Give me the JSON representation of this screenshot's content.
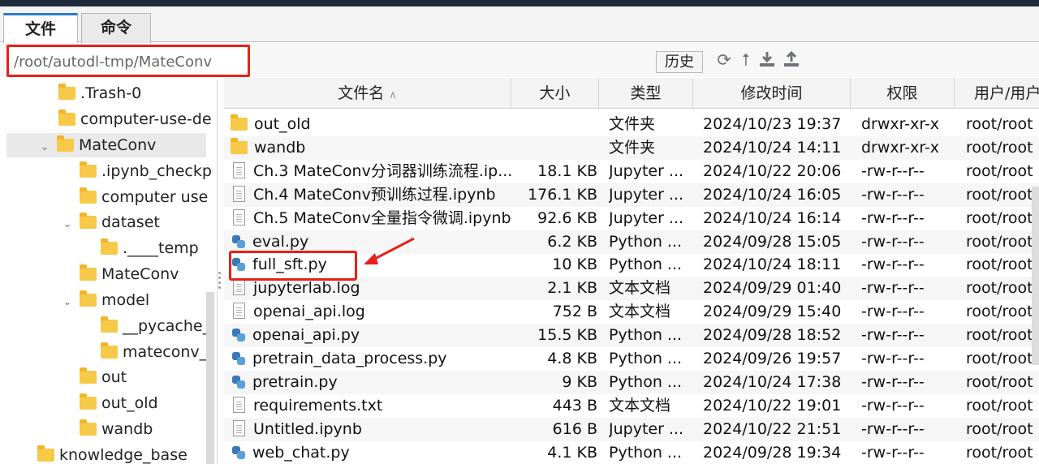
{
  "tabs": [
    {
      "label": "文件"
    },
    {
      "label": "命令"
    }
  ],
  "path": {
    "value": "/root/autodl-tmp/MateConv"
  },
  "toolbar": {
    "history_label": "历史",
    "icons": [
      "refresh-icon",
      "upload-up-icon",
      "download-icon",
      "upload-icon"
    ]
  },
  "tree": [
    {
      "label": ".Trash-0"
    },
    {
      "label": "computer-use-de"
    },
    {
      "label": "MateConv"
    },
    {
      "label": ".ipynb_checkp"
    },
    {
      "label": "computer use"
    },
    {
      "label": "dataset"
    },
    {
      "label": ".____temp"
    },
    {
      "label": "MateConv"
    },
    {
      "label": "model"
    },
    {
      "label": "__pycache_"
    },
    {
      "label": "mateconv_"
    },
    {
      "label": "out"
    },
    {
      "label": "out_old"
    },
    {
      "label": "wandb"
    },
    {
      "label": "knowledge_base"
    }
  ],
  "table": {
    "headers": {
      "name": "文件名",
      "size": "大小",
      "type": "类型",
      "modified": "修改时间",
      "perm": "权限",
      "user": "用户/用户"
    },
    "rows": [
      {
        "name": "out_old",
        "size": "",
        "type": "文件夹",
        "modified": "2024/10/23 19:37",
        "perm": "drwxr-xr-x",
        "user": "root/root",
        "icon": "folder"
      },
      {
        "name": "wandb",
        "size": "",
        "type": "文件夹",
        "modified": "2024/10/24 14:11",
        "perm": "drwxr-xr-x",
        "user": "root/root",
        "icon": "folder"
      },
      {
        "name": "Ch.3 MateConv分词器训练流程.ip...",
        "size": "18.1 KB",
        "type": "Jupyter ...",
        "modified": "2024/10/22 20:06",
        "perm": "-rw-r--r--",
        "user": "root/root",
        "icon": "doc"
      },
      {
        "name": "Ch.4 MateConv预训练过程.ipynb",
        "size": "176.1 KB",
        "type": "Jupyter ...",
        "modified": "2024/10/24 16:05",
        "perm": "-rw-r--r--",
        "user": "root/root",
        "icon": "doc"
      },
      {
        "name": "Ch.5 MateConv全量指令微调.ipynb",
        "size": "92.6 KB",
        "type": "Jupyter ...",
        "modified": "2024/10/24 16:14",
        "perm": "-rw-r--r--",
        "user": "root/root",
        "icon": "doc"
      },
      {
        "name": "eval.py",
        "size": "6.2 KB",
        "type": "Python ...",
        "modified": "2024/09/28 15:05",
        "perm": "-rw-r--r--",
        "user": "root/root",
        "icon": "py"
      },
      {
        "name": "full_sft.py",
        "size": "10 KB",
        "type": "Python ...",
        "modified": "2024/10/24 18:11",
        "perm": "-rw-r--r--",
        "user": "root/root",
        "icon": "py"
      },
      {
        "name": "jupyterlab.log",
        "size": "2.1 KB",
        "type": "文本文档",
        "modified": "2024/09/29 01:40",
        "perm": "-rw-r--r--",
        "user": "root/root",
        "icon": "doc"
      },
      {
        "name": "openai_api.log",
        "size": "752 B",
        "type": "文本文档",
        "modified": "2024/09/29 15:40",
        "perm": "-rw-r--r--",
        "user": "root/root",
        "icon": "doc"
      },
      {
        "name": "openai_api.py",
        "size": "15.5 KB",
        "type": "Python ...",
        "modified": "2024/09/28 18:52",
        "perm": "-rw-r--r--",
        "user": "root/root",
        "icon": "py"
      },
      {
        "name": "pretrain_data_process.py",
        "size": "4.8 KB",
        "type": "Python ...",
        "modified": "2024/09/26 19:57",
        "perm": "-rw-r--r--",
        "user": "root/root",
        "icon": "py"
      },
      {
        "name": "pretrain.py",
        "size": "9 KB",
        "type": "Python ...",
        "modified": "2024/10/24 17:38",
        "perm": "-rw-r--r--",
        "user": "root/root",
        "icon": "py"
      },
      {
        "name": "requirements.txt",
        "size": "443 B",
        "type": "文本文档",
        "modified": "2024/10/22 19:01",
        "perm": "-rw-r--r--",
        "user": "root/root",
        "icon": "doc"
      },
      {
        "name": "Untitled.ipynb",
        "size": "616 B",
        "type": "Jupyter ...",
        "modified": "2024/10/22 21:51",
        "perm": "-rw-r--r--",
        "user": "root/root",
        "icon": "doc"
      },
      {
        "name": "web_chat.py",
        "size": "4.1 KB",
        "type": "Python ...",
        "modified": "2024/09/28 19:34",
        "perm": "-rw-r--r--",
        "user": "root/root",
        "icon": "py"
      }
    ]
  },
  "colors": {
    "highlight": "#e8201a",
    "folder": "#f7c948",
    "accent": "#2d7ad6"
  }
}
